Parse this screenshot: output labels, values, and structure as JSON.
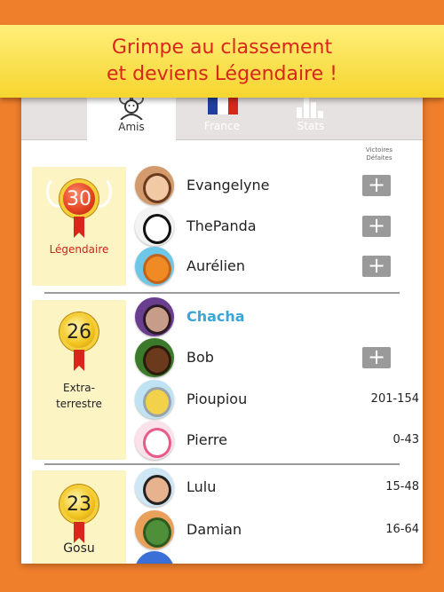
{
  "banner": {
    "line1": "Grimpe au classement",
    "line2": "et deviens Légendaire !"
  },
  "tabs": [
    {
      "label": "Amis",
      "icon": "friends-icon",
      "active": true
    },
    {
      "label": "France",
      "icon": "france-flag-icon",
      "active": false
    },
    {
      "label": "Stats",
      "icon": "bar-chart-icon",
      "active": false
    }
  ],
  "column_header": {
    "line1": "Victoires",
    "line2": "Défaites"
  },
  "tiers": [
    {
      "level": "30",
      "name": "Légendaire",
      "name_color": "#c8261b"
    },
    {
      "level": "26",
      "name_line1": "Extra-",
      "name_line2": "terrestre"
    },
    {
      "level": "23",
      "name": "Gosu"
    }
  ],
  "players": [
    {
      "name": "Evangelyne",
      "action": "+",
      "avatar": "avatar-woman"
    },
    {
      "name": "ThePanda",
      "action": "+",
      "avatar": "avatar-panda"
    },
    {
      "name": "Aurélien",
      "action": "+",
      "avatar": "avatar-pumpkin"
    },
    {
      "name": "Chacha",
      "is_current_user": true,
      "avatar": "avatar-woman-purple"
    },
    {
      "name": "Bob",
      "action": "+",
      "avatar": "avatar-monster"
    },
    {
      "name": "Pioupiou",
      "score": "201-154",
      "avatar": "avatar-bird"
    },
    {
      "name": "Pierre",
      "score": "0-43",
      "avatar": "avatar-cartoon"
    },
    {
      "name": "Lulu",
      "score": "15-48",
      "avatar": "avatar-man-glasses"
    },
    {
      "name": "Damian",
      "score": "16-64",
      "avatar": "avatar-dinosaur"
    }
  ],
  "colors": {
    "background": "#f07f2c",
    "banner": "#f6d52f",
    "banner_text": "#d8261b",
    "current_user": "#39a6d8",
    "tier_panel": "#fdf4c4"
  }
}
